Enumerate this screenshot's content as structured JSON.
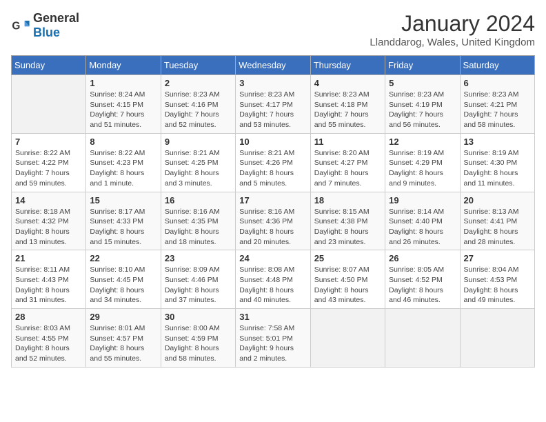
{
  "header": {
    "logo_general": "General",
    "logo_blue": "Blue",
    "month_title": "January 2024",
    "location": "Llanddarog, Wales, United Kingdom"
  },
  "days_of_week": [
    "Sunday",
    "Monday",
    "Tuesday",
    "Wednesday",
    "Thursday",
    "Friday",
    "Saturday"
  ],
  "weeks": [
    [
      {
        "date": "",
        "info": ""
      },
      {
        "date": "1",
        "info": "Sunrise: 8:24 AM\nSunset: 4:15 PM\nDaylight: 7 hours\nand 51 minutes."
      },
      {
        "date": "2",
        "info": "Sunrise: 8:23 AM\nSunset: 4:16 PM\nDaylight: 7 hours\nand 52 minutes."
      },
      {
        "date": "3",
        "info": "Sunrise: 8:23 AM\nSunset: 4:17 PM\nDaylight: 7 hours\nand 53 minutes."
      },
      {
        "date": "4",
        "info": "Sunrise: 8:23 AM\nSunset: 4:18 PM\nDaylight: 7 hours\nand 55 minutes."
      },
      {
        "date": "5",
        "info": "Sunrise: 8:23 AM\nSunset: 4:19 PM\nDaylight: 7 hours\nand 56 minutes."
      },
      {
        "date": "6",
        "info": "Sunrise: 8:23 AM\nSunset: 4:21 PM\nDaylight: 7 hours\nand 58 minutes."
      }
    ],
    [
      {
        "date": "7",
        "info": "Sunrise: 8:22 AM\nSunset: 4:22 PM\nDaylight: 7 hours\nand 59 minutes."
      },
      {
        "date": "8",
        "info": "Sunrise: 8:22 AM\nSunset: 4:23 PM\nDaylight: 8 hours\nand 1 minute."
      },
      {
        "date": "9",
        "info": "Sunrise: 8:21 AM\nSunset: 4:25 PM\nDaylight: 8 hours\nand 3 minutes."
      },
      {
        "date": "10",
        "info": "Sunrise: 8:21 AM\nSunset: 4:26 PM\nDaylight: 8 hours\nand 5 minutes."
      },
      {
        "date": "11",
        "info": "Sunrise: 8:20 AM\nSunset: 4:27 PM\nDaylight: 8 hours\nand 7 minutes."
      },
      {
        "date": "12",
        "info": "Sunrise: 8:19 AM\nSunset: 4:29 PM\nDaylight: 8 hours\nand 9 minutes."
      },
      {
        "date": "13",
        "info": "Sunrise: 8:19 AM\nSunset: 4:30 PM\nDaylight: 8 hours\nand 11 minutes."
      }
    ],
    [
      {
        "date": "14",
        "info": "Sunrise: 8:18 AM\nSunset: 4:32 PM\nDaylight: 8 hours\nand 13 minutes."
      },
      {
        "date": "15",
        "info": "Sunrise: 8:17 AM\nSunset: 4:33 PM\nDaylight: 8 hours\nand 15 minutes."
      },
      {
        "date": "16",
        "info": "Sunrise: 8:16 AM\nSunset: 4:35 PM\nDaylight: 8 hours\nand 18 minutes."
      },
      {
        "date": "17",
        "info": "Sunrise: 8:16 AM\nSunset: 4:36 PM\nDaylight: 8 hours\nand 20 minutes."
      },
      {
        "date": "18",
        "info": "Sunrise: 8:15 AM\nSunset: 4:38 PM\nDaylight: 8 hours\nand 23 minutes."
      },
      {
        "date": "19",
        "info": "Sunrise: 8:14 AM\nSunset: 4:40 PM\nDaylight: 8 hours\nand 26 minutes."
      },
      {
        "date": "20",
        "info": "Sunrise: 8:13 AM\nSunset: 4:41 PM\nDaylight: 8 hours\nand 28 minutes."
      }
    ],
    [
      {
        "date": "21",
        "info": "Sunrise: 8:11 AM\nSunset: 4:43 PM\nDaylight: 8 hours\nand 31 minutes."
      },
      {
        "date": "22",
        "info": "Sunrise: 8:10 AM\nSunset: 4:45 PM\nDaylight: 8 hours\nand 34 minutes."
      },
      {
        "date": "23",
        "info": "Sunrise: 8:09 AM\nSunset: 4:46 PM\nDaylight: 8 hours\nand 37 minutes."
      },
      {
        "date": "24",
        "info": "Sunrise: 8:08 AM\nSunset: 4:48 PM\nDaylight: 8 hours\nand 40 minutes."
      },
      {
        "date": "25",
        "info": "Sunrise: 8:07 AM\nSunset: 4:50 PM\nDaylight: 8 hours\nand 43 minutes."
      },
      {
        "date": "26",
        "info": "Sunrise: 8:05 AM\nSunset: 4:52 PM\nDaylight: 8 hours\nand 46 minutes."
      },
      {
        "date": "27",
        "info": "Sunrise: 8:04 AM\nSunset: 4:53 PM\nDaylight: 8 hours\nand 49 minutes."
      }
    ],
    [
      {
        "date": "28",
        "info": "Sunrise: 8:03 AM\nSunset: 4:55 PM\nDaylight: 8 hours\nand 52 minutes."
      },
      {
        "date": "29",
        "info": "Sunrise: 8:01 AM\nSunset: 4:57 PM\nDaylight: 8 hours\nand 55 minutes."
      },
      {
        "date": "30",
        "info": "Sunrise: 8:00 AM\nSunset: 4:59 PM\nDaylight: 8 hours\nand 58 minutes."
      },
      {
        "date": "31",
        "info": "Sunrise: 7:58 AM\nSunset: 5:01 PM\nDaylight: 9 hours\nand 2 minutes."
      },
      {
        "date": "",
        "info": ""
      },
      {
        "date": "",
        "info": ""
      },
      {
        "date": "",
        "info": ""
      }
    ]
  ]
}
